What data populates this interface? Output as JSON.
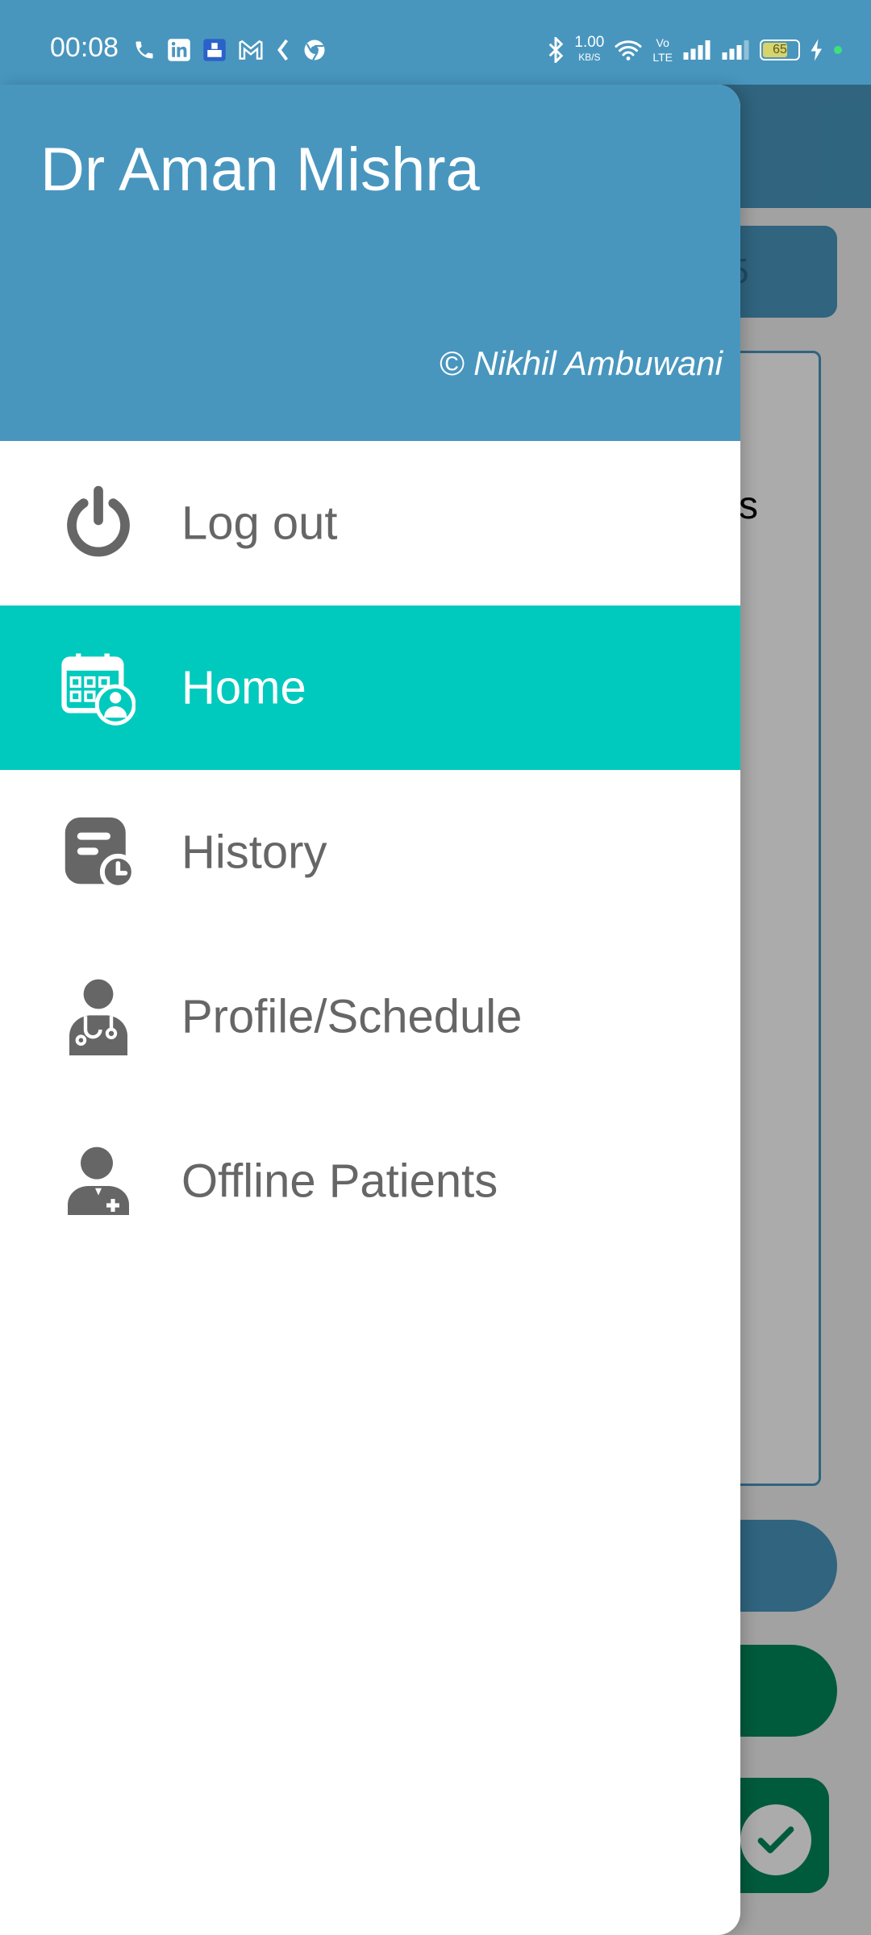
{
  "status_bar": {
    "time": "00:08",
    "net_speed_value": "1.00",
    "net_speed_unit": "KB/S",
    "volte_top": "Vo",
    "volte_bottom": "LTE",
    "battery_level": "65",
    "left_icons": [
      "phone-icon",
      "linkedin-icon",
      "app-icon",
      "gmail-icon",
      "kite-icon",
      "chrome-icon"
    ],
    "right_icons": [
      "bluetooth-icon",
      "wifi-icon",
      "signal-icon",
      "signal-icon",
      "charging-icon"
    ]
  },
  "drawer": {
    "title": "Dr Aman Mishra",
    "credit": "© Nikhil Ambuwani",
    "items": [
      {
        "label": "Log out",
        "icon": "power-icon",
        "active": false
      },
      {
        "label": "Home",
        "icon": "calendar-doctor-icon",
        "active": true
      },
      {
        "label": "History",
        "icon": "history-icon",
        "active": false
      },
      {
        "label": "Profile/Schedule",
        "icon": "doctor-icon",
        "active": false
      },
      {
        "label": "Offline Patients",
        "icon": "add-patient-icon",
        "active": false
      }
    ]
  },
  "background": {
    "chip_text": "5",
    "card_text": "s"
  },
  "colors": {
    "primary": "#4896be",
    "active_item": "#00cabd",
    "menu_text": "#666666",
    "green": "#00885a"
  }
}
